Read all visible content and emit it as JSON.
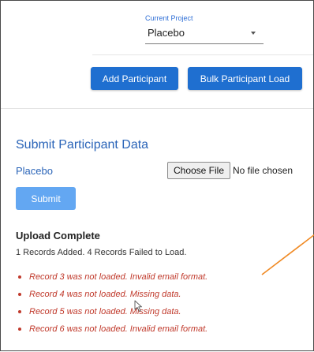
{
  "project": {
    "label": "Current Project",
    "value": "Placebo"
  },
  "actions": {
    "add_participant": "Add Participant",
    "bulk_load": "Bulk Participant Load"
  },
  "submit_section": {
    "title": "Submit Participant Data",
    "project_name": "Placebo",
    "choose_file": "Choose File",
    "file_status": "No file chosen",
    "submit": "Submit"
  },
  "upload": {
    "title": "Upload Complete",
    "summary": "1 Records Added. 4 Records Failed to Load.",
    "errors": [
      "Record 3 was not loaded. Invalid email format.",
      "Record 4 was not loaded. Missing data.",
      "Record 5 was not loaded. Missing data.",
      "Record 6 was not loaded. Invalid email format."
    ]
  },
  "colors": {
    "primary": "#1f6fd0",
    "submit_disabled": "#63a7f2",
    "heading_blue": "#2a64b8",
    "error_red": "#c0392b",
    "annotation_orange": "#f08a24"
  },
  "icons": {
    "dropdown": "chevron-down-icon",
    "cursor": "mouse-pointer-icon"
  }
}
